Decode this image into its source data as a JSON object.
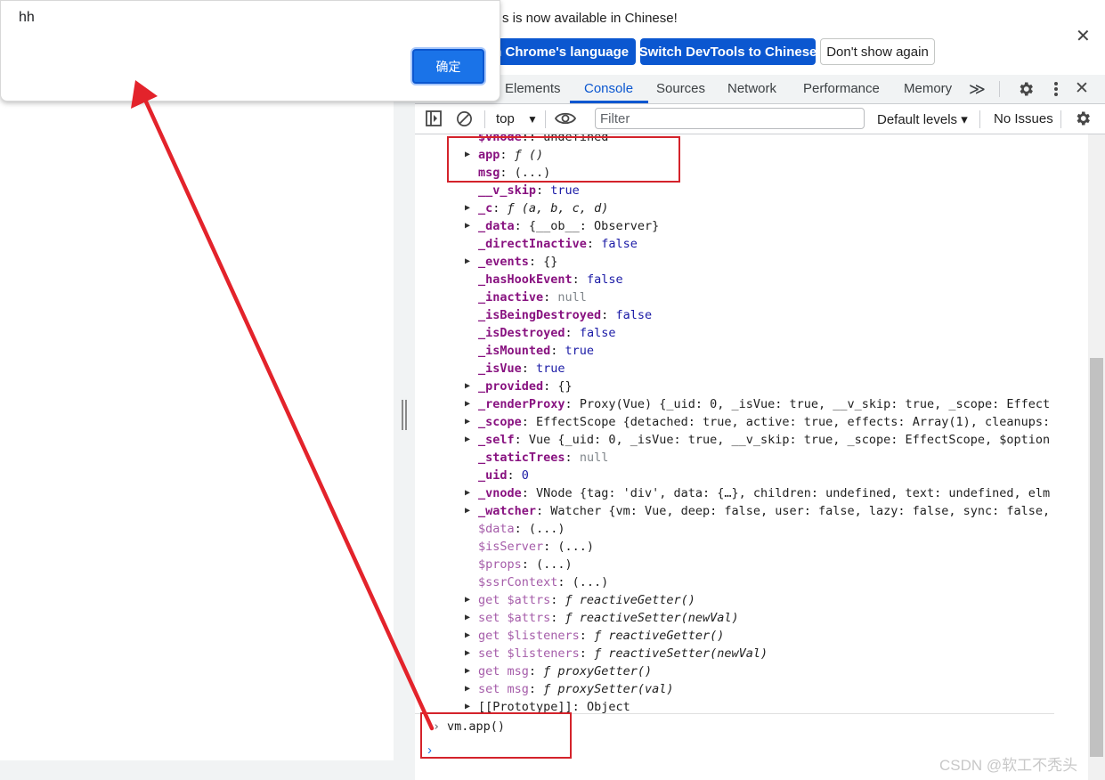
{
  "alert": {
    "message": "hh",
    "ok_label": "确定"
  },
  "devtools": {
    "notice": {
      "text": "DevTools is now available in Chinese!",
      "visible_text": "s is now available in Chinese!",
      "switch_language_label": "Switch to Chrome's language",
      "switch_language_visible": "ch Chrome's language",
      "switch_devtools_label": "Switch DevTools to Chinese",
      "dont_show_label": "Don't show again"
    },
    "tabs": [
      {
        "label": "Elements",
        "active": false
      },
      {
        "label": "Console",
        "active": true
      },
      {
        "label": "Sources",
        "active": false
      },
      {
        "label": "Network",
        "active": false
      },
      {
        "label": "Performance",
        "active": false
      },
      {
        "label": "Memory",
        "active": false
      }
    ],
    "more_tabs_glyph": "≫",
    "toolbar": {
      "context": "top",
      "filter_placeholder": "Filter",
      "levels": "Default levels ▾",
      "issues": "No Issues"
    },
    "console": {
      "lines": [
        {
          "tri": false,
          "kind": "clip",
          "name": "$vnode",
          "value": ": undefined"
        },
        {
          "tri": true,
          "kind": "own",
          "name": "app",
          "value": " ƒ ()",
          "vclass": "v-f"
        },
        {
          "tri": false,
          "kind": "own",
          "name": "msg",
          "value": " (...)"
        },
        {
          "tri": false,
          "kind": "own",
          "name": "__v_skip",
          "value": " true",
          "vclass": "v-b"
        },
        {
          "tri": true,
          "kind": "own",
          "name": "_c",
          "value": " ƒ (a, b, c, d)",
          "vclass": "v-f"
        },
        {
          "tri": true,
          "kind": "own",
          "name": "_data",
          "value": " {__ob__: Observer}"
        },
        {
          "tri": false,
          "kind": "own",
          "name": "_directInactive",
          "value": " false",
          "vclass": "v-b"
        },
        {
          "tri": true,
          "kind": "own",
          "name": "_events",
          "value": " {}"
        },
        {
          "tri": false,
          "kind": "own",
          "name": "_hasHookEvent",
          "value": " false",
          "vclass": "v-b"
        },
        {
          "tri": false,
          "kind": "own",
          "name": "_inactive",
          "value": " null",
          "vclass": "v-u"
        },
        {
          "tri": false,
          "kind": "own",
          "name": "_isBeingDestroyed",
          "value": " false",
          "vclass": "v-b"
        },
        {
          "tri": false,
          "kind": "own",
          "name": "_isDestroyed",
          "value": " false",
          "vclass": "v-b"
        },
        {
          "tri": false,
          "kind": "own",
          "name": "_isMounted",
          "value": " true",
          "vclass": "v-b"
        },
        {
          "tri": false,
          "kind": "own",
          "name": "_isVue",
          "value": " true",
          "vclass": "v-b"
        },
        {
          "tri": true,
          "kind": "own",
          "name": "_provided",
          "value": " {}"
        },
        {
          "tri": true,
          "kind": "own",
          "name": "_renderProxy",
          "value": " Proxy(Vue) {_uid: 0, _isVue: true, __v_skip: true, _scope: Effect"
        },
        {
          "tri": true,
          "kind": "own",
          "name": "_scope",
          "value": " EffectScope {detached: true, active: true, effects: Array(1), cleanups:"
        },
        {
          "tri": true,
          "kind": "own",
          "name": "_self",
          "value": " Vue {_uid: 0, _isVue: true, __v_skip: true, _scope: EffectScope, $option"
        },
        {
          "tri": false,
          "kind": "own",
          "name": "_staticTrees",
          "value": " null",
          "vclass": "v-u"
        },
        {
          "tri": false,
          "kind": "own",
          "name": "_uid",
          "value": " 0",
          "vclass": "v-n"
        },
        {
          "tri": true,
          "kind": "own",
          "name": "_vnode",
          "value": " VNode {tag: 'div', data: {…}, children: undefined, text: undefined, elm"
        },
        {
          "tri": true,
          "kind": "own",
          "name": "_watcher",
          "value": " Watcher {vm: Vue, deep: false, user: false, lazy: false, sync: false,"
        },
        {
          "tri": false,
          "kind": "dim",
          "name": "$data",
          "value": " (...)"
        },
        {
          "tri": false,
          "kind": "dim",
          "name": "$isServer",
          "value": " (...)"
        },
        {
          "tri": false,
          "kind": "dim",
          "name": "$props",
          "value": " (...)"
        },
        {
          "tri": false,
          "kind": "dim",
          "name": "$ssrContext",
          "value": " (...)"
        },
        {
          "tri": true,
          "kind": "dim",
          "name": "get $attrs",
          "value": " ƒ reactiveGetter()",
          "vclass": "v-f"
        },
        {
          "tri": true,
          "kind": "dim",
          "name": "set $attrs",
          "value": " ƒ reactiveSetter(newVal)",
          "vclass": "v-f"
        },
        {
          "tri": true,
          "kind": "dim",
          "name": "get $listeners",
          "value": " ƒ reactiveGetter()",
          "vclass": "v-f"
        },
        {
          "tri": true,
          "kind": "dim",
          "name": "set $listeners",
          "value": " ƒ reactiveSetter(newVal)",
          "vclass": "v-f"
        },
        {
          "tri": true,
          "kind": "dim",
          "name": "get msg",
          "value": " ƒ proxyGetter()",
          "vclass": "v-f"
        },
        {
          "tri": true,
          "kind": "dim",
          "name": "set msg",
          "value": " ƒ proxySetter(val)",
          "vclass": "v-f"
        },
        {
          "tri": true,
          "kind": "plain",
          "name": "[[Prototype]]",
          "value": " Object"
        }
      ],
      "prompt_input": "vm.app()",
      "prompt_caret": "›"
    }
  },
  "watermark": "CSDN @软工不秃头",
  "colors": {
    "accent": "#0b57d0",
    "highlight_box": "#d4232b",
    "arrow": "#e3232b"
  },
  "icons": [
    "close-icon",
    "settings-icon",
    "more-vert-icon",
    "sidebar-toggle-icon",
    "clear-console-icon",
    "eye-icon",
    "gear-icon",
    "resize-grip-icon",
    "dropdown-caret-icon"
  ]
}
